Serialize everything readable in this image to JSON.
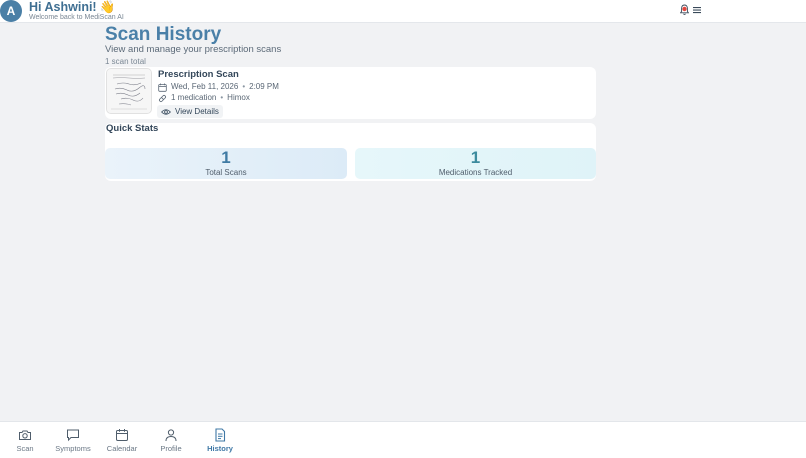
{
  "header": {
    "avatar_initial": "A",
    "greeting": "Hi Ashwini!",
    "wave_emoji": "👋",
    "subtitle": "Welcome back to MediScan AI",
    "icons": [
      "bell-icon",
      "menu-icon"
    ]
  },
  "main": {
    "title": "Scan History",
    "subtitle": "View and manage your prescription scans",
    "scan_count": "1 scan total",
    "scans": [
      {
        "title": "Prescription Scan",
        "date": "Wed, Feb 11, 2026",
        "time": "2:09 PM",
        "medications": "1 medication",
        "drug": "Himox",
        "view_label": "View Details"
      }
    ],
    "quick_stats": {
      "title": "Quick Stats",
      "items": [
        {
          "value": "1",
          "label": "Total Scans"
        },
        {
          "value": "1",
          "label": "Medications Tracked"
        }
      ]
    }
  },
  "nav": {
    "active": "History",
    "items": [
      {
        "label": "Scan",
        "icon": "camera-icon"
      },
      {
        "label": "Symptoms",
        "icon": "chat-icon"
      },
      {
        "label": "Calendar",
        "icon": "calendar-icon"
      },
      {
        "label": "Profile",
        "icon": "user-icon"
      },
      {
        "label": "History",
        "icon": "document-icon"
      }
    ]
  },
  "colors": {
    "accent": "#4a80a8",
    "background": "#f1f2f4",
    "bell_dot": "#e2473d"
  }
}
